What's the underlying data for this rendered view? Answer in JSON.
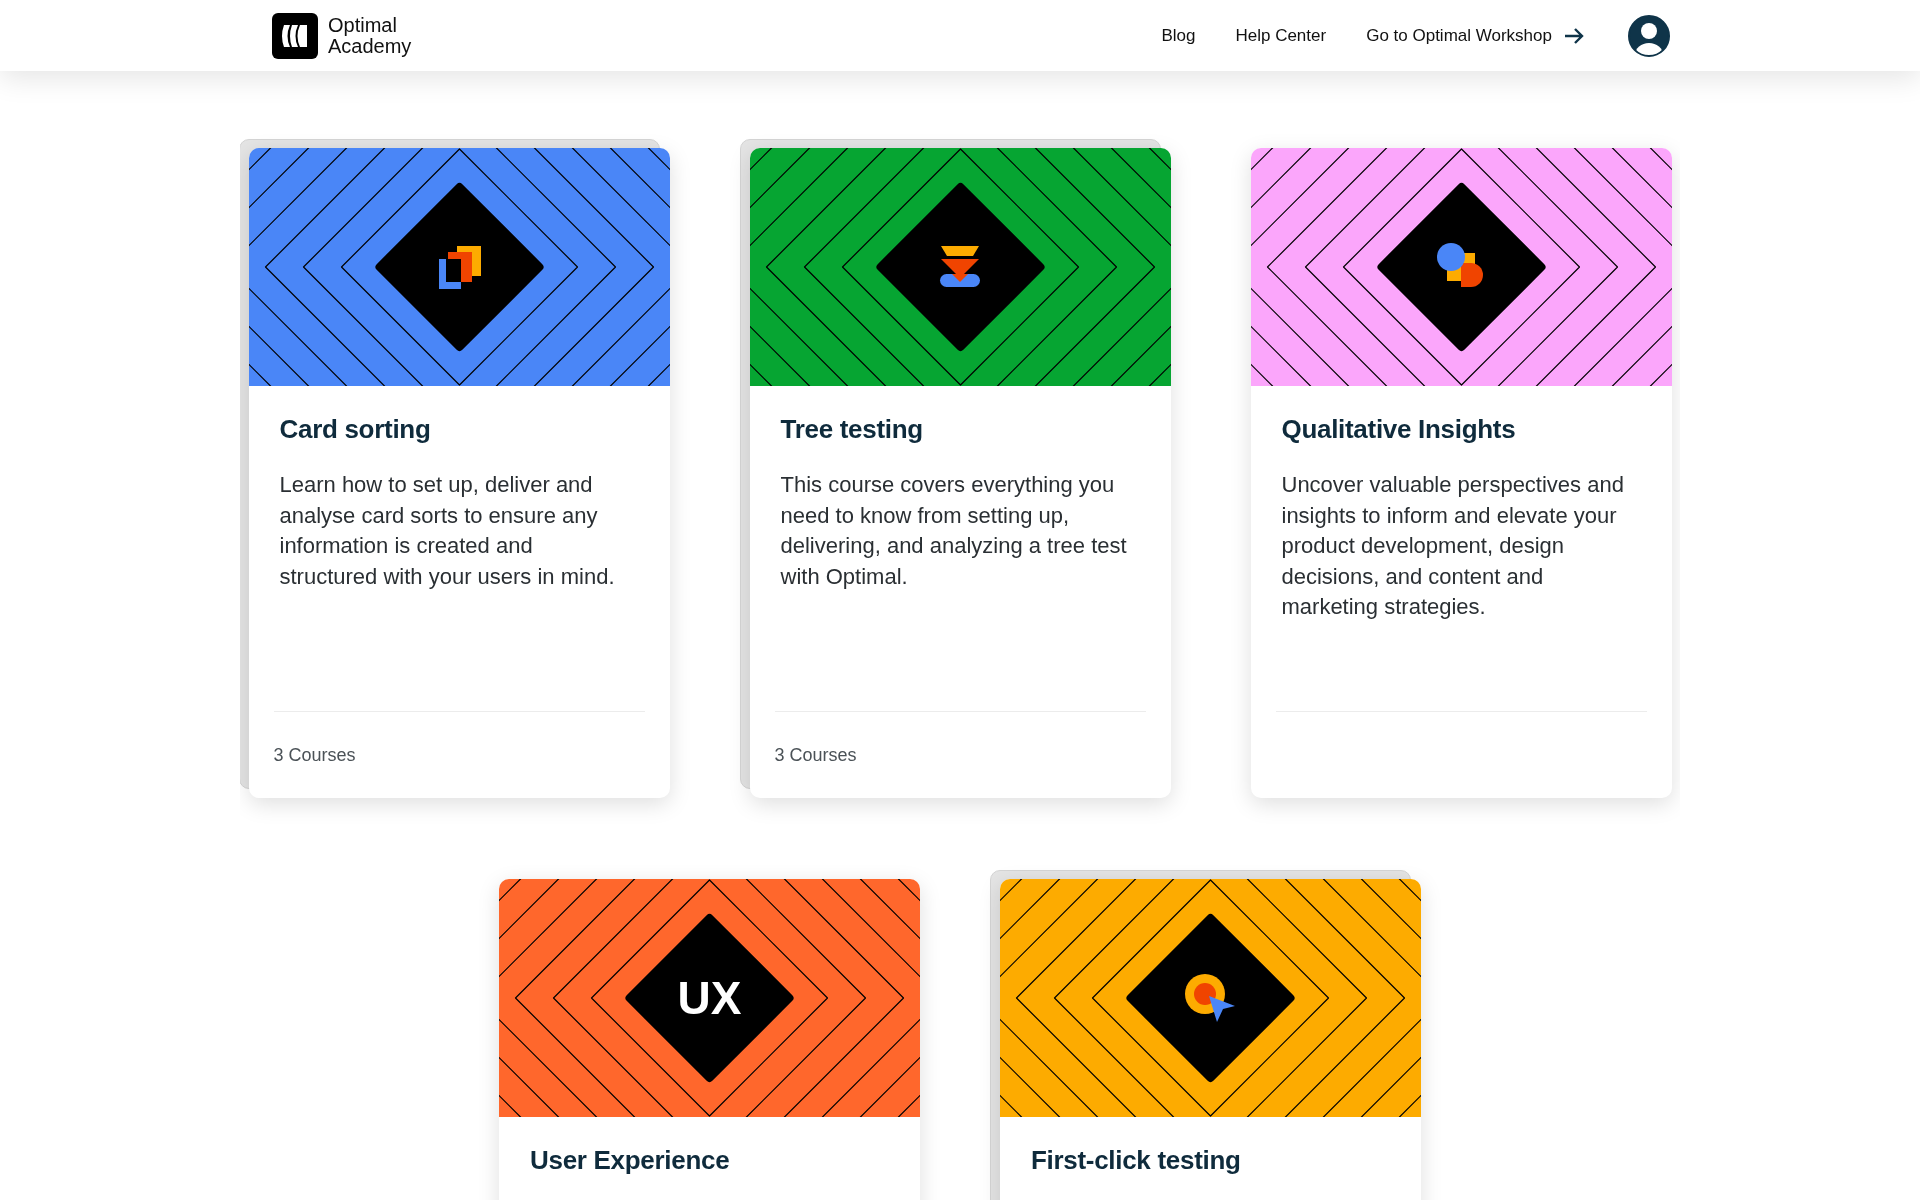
{
  "header": {
    "logo_text": [
      "Optimal",
      "Academy"
    ],
    "nav": [
      {
        "label": "Blog",
        "arrow": false
      },
      {
        "label": "Help Center",
        "arrow": false
      },
      {
        "label": "Go to Optimal Workshop",
        "arrow": true
      }
    ]
  },
  "cards": [
    {
      "title": "Card sorting",
      "description": "Learn how to set up, deliver and analyse card sorts to ensure any information is created and structured with your users in mind.",
      "courses": "3 Courses",
      "color": "#4a86f7",
      "kind": "cards",
      "stacked": true
    },
    {
      "title": "Tree testing",
      "description": "This course covers everything you need to know from setting up, delivering, and analyzing a tree test with Optimal.",
      "courses": "3 Courses",
      "color": "#06a532",
      "kind": "tree",
      "stacked": true
    },
    {
      "title": "Qualitative Insights",
      "description": "Uncover valuable perspectives and insights to inform and elevate your product development, design decisions, and content and marketing strategies.",
      "color": "#fba6fb",
      "kind": "shapes",
      "stacked": false
    },
    {
      "title": "User Experience",
      "color": "#ff672c",
      "kind": "ux",
      "icon_text": "UX",
      "stacked": false
    },
    {
      "title": "First-click testing",
      "color": "#fdab00",
      "kind": "target",
      "stacked": true
    }
  ]
}
